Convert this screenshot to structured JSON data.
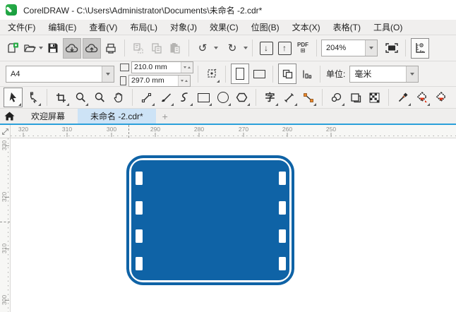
{
  "title_bar": {
    "title": "CorelDRAW - C:\\Users\\Administrator\\Documents\\未命名 -2.cdr*"
  },
  "menu_bar": {
    "items": [
      {
        "label": "文件(F)"
      },
      {
        "label": "编辑(E)"
      },
      {
        "label": "查看(V)"
      },
      {
        "label": "布局(L)"
      },
      {
        "label": "对象(J)"
      },
      {
        "label": "效果(C)"
      },
      {
        "label": "位图(B)"
      },
      {
        "label": "文本(X)"
      },
      {
        "label": "表格(T)"
      },
      {
        "label": "工具(O)"
      }
    ]
  },
  "toolbar": {
    "undo_glyph": "↺",
    "redo_glyph": "↻",
    "import_glyph": "↓",
    "export_glyph": "↑",
    "pdf_label": "PDF",
    "zoom_value": "204%",
    "icons": [
      "new-document",
      "open",
      "save",
      "cloud-download",
      "cloud-upload",
      "print",
      "cut",
      "copy",
      "paste",
      "undo",
      "redo",
      "import",
      "export",
      "publish-pdf",
      "zoom-levels",
      "fullscreen-preview",
      "show-rulers"
    ]
  },
  "property_bar": {
    "page_size_value": "A4",
    "width_value": "210.0 mm",
    "height_value": "297.0 mm",
    "units_label": "单位:",
    "units_value": "毫米",
    "icons": [
      "page-width",
      "page-height",
      "autofit-page",
      "portrait",
      "landscape",
      "all-pages",
      "current-page"
    ]
  },
  "toolbox": {
    "text_tool_glyph": "字",
    "tools": [
      "pick",
      "shape",
      "crop",
      "zoom",
      "magnifier",
      "pan",
      "freehand",
      "artistic-media",
      "pen",
      "rectangle",
      "ellipse",
      "polygon",
      "text",
      "dimension",
      "connector",
      "drop-shadow",
      "transparency",
      "mesh-fill",
      "color-eyedropper",
      "interactive-fill",
      "smart-fill"
    ]
  },
  "tabs": {
    "welcome_label": "欢迎屏幕",
    "document_label": "未命名 -2.cdr*",
    "new_tab_label": "+"
  },
  "ruler_h": {
    "labels": [
      {
        "text": "320"
      },
      {
        "text": "310"
      },
      {
        "text": "300"
      },
      {
        "text": "290"
      },
      {
        "text": "280"
      },
      {
        "text": "270"
      },
      {
        "text": "260"
      },
      {
        "text": "250"
      }
    ]
  },
  "ruler_v": {
    "labels": [
      {
        "text": "330"
      },
      {
        "text": "320"
      },
      {
        "text": "310"
      },
      {
        "text": "300"
      }
    ]
  },
  "canvas": {
    "shape": "film-strip-rounded-rectangle",
    "shape_color": "#0f63a6",
    "hole_color": "#ffffff"
  }
}
